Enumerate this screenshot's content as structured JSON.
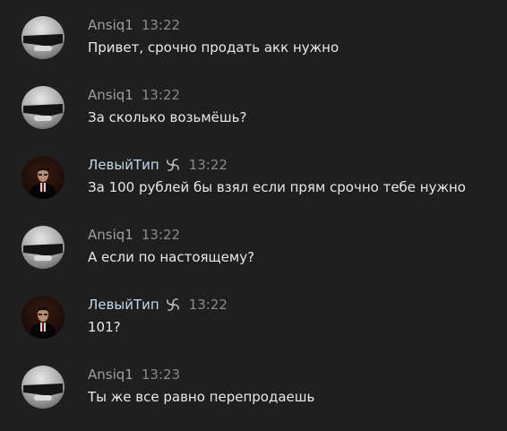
{
  "messages": [
    {
      "author": "Ansiq1",
      "time": "13:22",
      "text": "Привет, срочно продать акк нужно",
      "avatar": "ansiq-avatar"
    },
    {
      "author": "Ansiq1",
      "time": "13:22",
      "text": "За сколько возьмёшь?",
      "avatar": "ansiq-avatar"
    },
    {
      "author": "ЛевыйТип",
      "time": "13:22",
      "text": "За 100 рублей бы взял если прям срочно тебе нужно",
      "avatar": "levytip-avatar",
      "badge": "spiral-badge-icon"
    },
    {
      "author": "Ansiq1",
      "time": "13:22",
      "text": "А если по настоящему?",
      "avatar": "ansiq-avatar"
    },
    {
      "author": "ЛевыйТип",
      "time": "13:22",
      "text": "101?",
      "avatar": "levytip-avatar",
      "badge": "spiral-badge-icon"
    },
    {
      "author": "Ansiq1",
      "time": "13:23",
      "text": "Ты же все равно перепродаешь",
      "avatar": "ansiq-avatar"
    }
  ],
  "colors": {
    "background": "#1f1f1f",
    "author_default": "#9e9e9e",
    "author_highlight": "#c4d8e8",
    "timestamp": "#8a8a8a",
    "message_text": "#e8e8e8"
  }
}
